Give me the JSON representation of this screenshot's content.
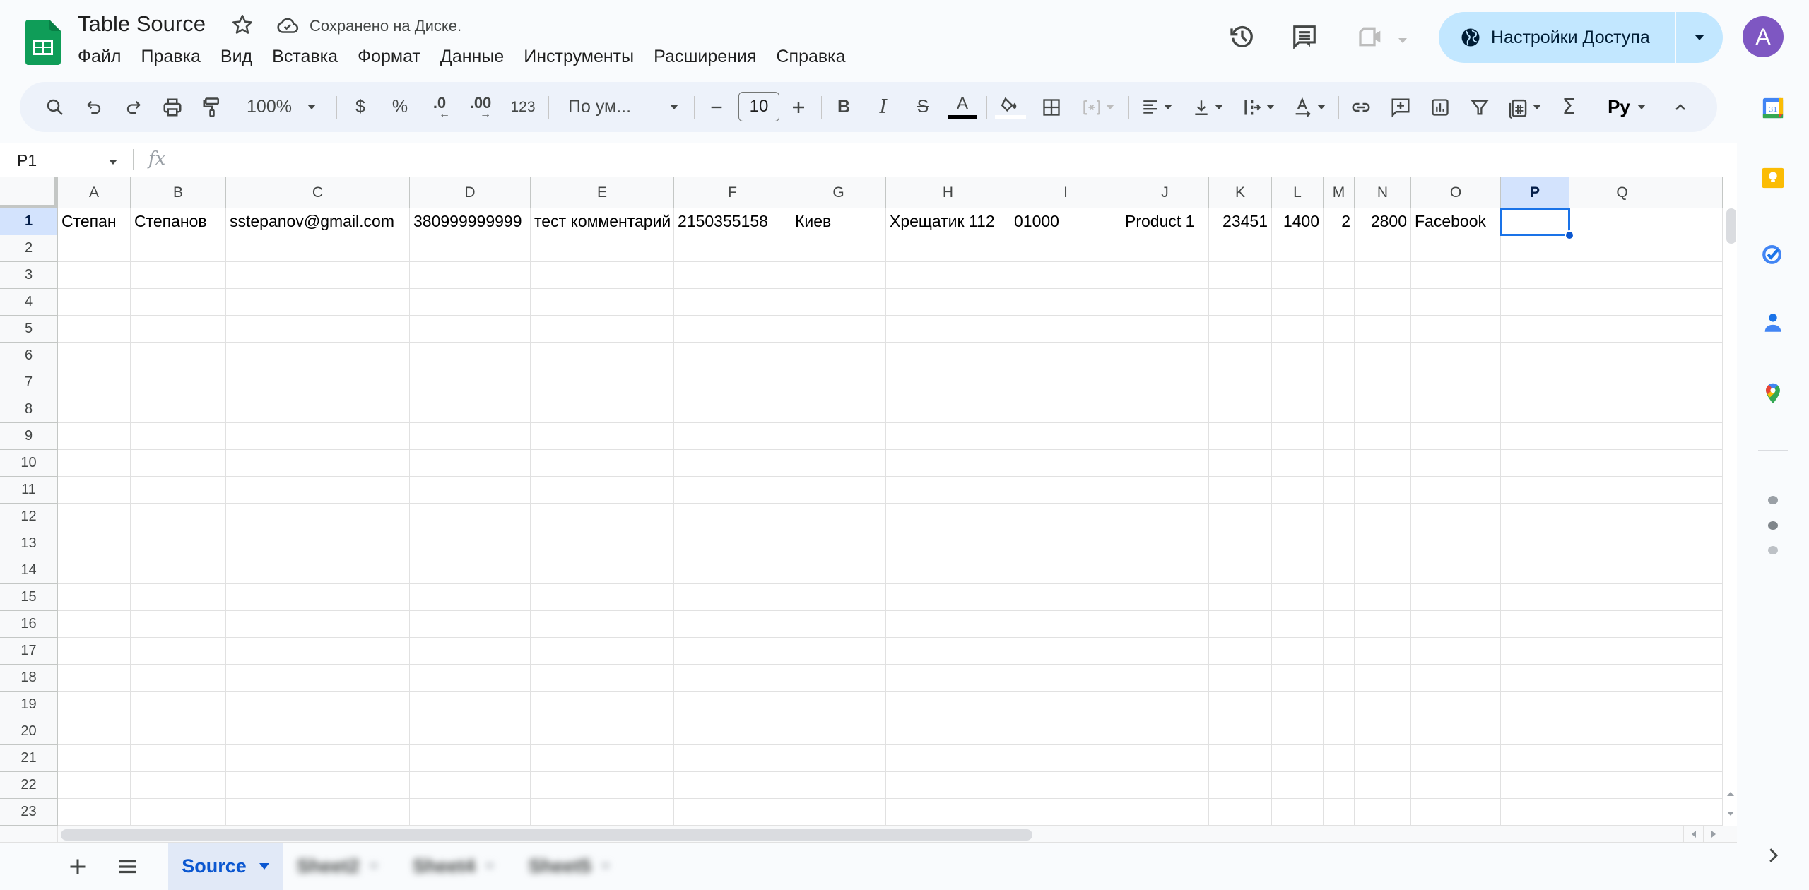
{
  "header": {
    "title": "Table Source",
    "save_status": "Сохранено на Диске.",
    "menu": [
      "Файл",
      "Правка",
      "Вид",
      "Вставка",
      "Формат",
      "Данные",
      "Инструменты",
      "Расширения",
      "Справка"
    ],
    "share_label": "Настройки Доступа",
    "avatar_letter": "A",
    "colors": {
      "share_bg": "#c2e7ff",
      "avatar_bg": "#7e57c2",
      "accent": "#0b57d0"
    }
  },
  "toolbar": {
    "zoom": "100%",
    "currency": "$",
    "percent": "%",
    "decrease_decimals": ".0",
    "increase_decimals": ".00",
    "number_format": "123",
    "font": "По ум...",
    "font_size": "10",
    "input_tools": "Py"
  },
  "formula_bar": {
    "name_box": "P1",
    "fx": "fx",
    "value": ""
  },
  "grid": {
    "columns": [
      "A",
      "B",
      "C",
      "D",
      "E",
      "F",
      "G",
      "H",
      "I",
      "J",
      "K",
      "L",
      "M",
      "N",
      "O",
      "P",
      "Q",
      ""
    ],
    "selected_column": "P",
    "selected_row": 1,
    "selected_cell": "P1",
    "rows": [
      "1",
      "2",
      "3",
      "4",
      "5",
      "6",
      "7",
      "8",
      "9",
      "10",
      "11",
      "12",
      "13",
      "14",
      "15",
      "16",
      "17",
      "18",
      "19",
      "20",
      "21",
      "22",
      "23"
    ],
    "row1": [
      {
        "col": "A",
        "value": "Степан",
        "align": "left"
      },
      {
        "col": "B",
        "value": "Степанов",
        "align": "left"
      },
      {
        "col": "C",
        "value": "sstepanov@gmail.com",
        "align": "left"
      },
      {
        "col": "D",
        "value": "380999999999",
        "align": "left"
      },
      {
        "col": "E",
        "value": "тест комментарий",
        "align": "left"
      },
      {
        "col": "F",
        "value": "2150355158",
        "align": "left"
      },
      {
        "col": "G",
        "value": "Киев",
        "align": "left"
      },
      {
        "col": "H",
        "value": "Хрещатик 112",
        "align": "left"
      },
      {
        "col": "I",
        "value": "01000",
        "align": "left"
      },
      {
        "col": "J",
        "value": "Product 1",
        "align": "left"
      },
      {
        "col": "K",
        "value": "23451",
        "align": "right"
      },
      {
        "col": "L",
        "value": "1400",
        "align": "right"
      },
      {
        "col": "M",
        "value": "2",
        "align": "right"
      },
      {
        "col": "N",
        "value": "2800",
        "align": "right"
      },
      {
        "col": "O",
        "value": "Facebook",
        "align": "left"
      },
      {
        "col": "P",
        "value": "",
        "align": "left"
      },
      {
        "col": "Q",
        "value": "",
        "align": "left"
      }
    ]
  },
  "sheets": {
    "active": "Source",
    "others_blurred": [
      "Sheet2",
      "Sheet4",
      "Sheet5"
    ]
  },
  "side_panel": {
    "apps": [
      "calendar",
      "keep",
      "tasks",
      "contacts",
      "maps"
    ]
  }
}
